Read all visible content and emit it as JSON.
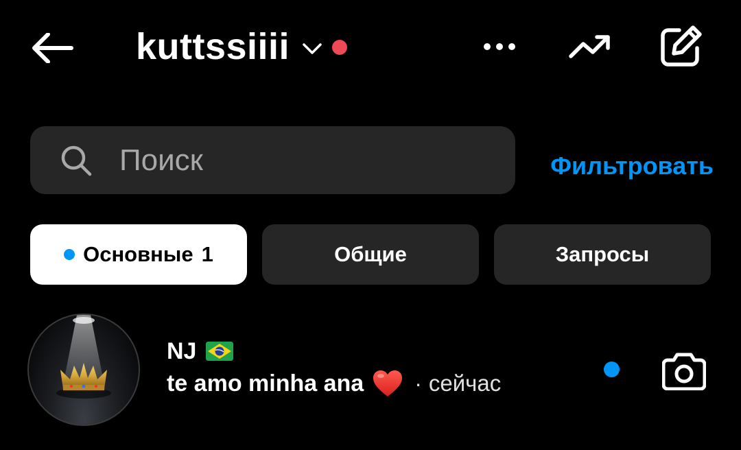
{
  "header": {
    "title": "kuttssiiii",
    "back_icon": "arrow-left-icon",
    "account_switch_icon": "chevron-down-icon",
    "more_icon": "more-horizontal-icon",
    "trend_icon": "trending-up-icon",
    "compose_icon": "edit-compose-icon",
    "notification_dot_color": "#ed4956"
  },
  "search": {
    "placeholder": "Поиск",
    "value": "",
    "icon": "search-icon"
  },
  "filter": {
    "label": "Фильтровать",
    "color": "#0095f6"
  },
  "tabs": [
    {
      "label": "Основные",
      "count": "1",
      "active": true,
      "dot_color": "#0095f6"
    },
    {
      "label": "Общие",
      "active": false
    },
    {
      "label": "Запросы",
      "active": false
    }
  ],
  "conversations": [
    {
      "name": "NJ",
      "name_emoji": "brazil-flag-icon",
      "message": "te amo minha ana",
      "message_emoji": "red-heart-icon",
      "separator": "·",
      "time": "сейчас",
      "unread": true,
      "unread_color": "#0095f6",
      "action_icon": "camera-icon"
    }
  ]
}
